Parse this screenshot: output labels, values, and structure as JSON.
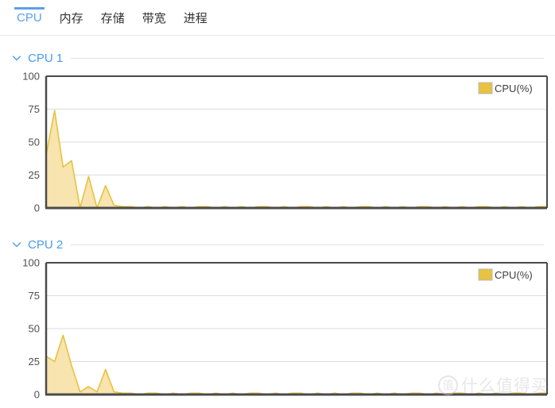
{
  "tabs": [
    {
      "label": "CPU",
      "active": true
    },
    {
      "label": "内存",
      "active": false
    },
    {
      "label": "存储",
      "active": false
    },
    {
      "label": "带宽",
      "active": false
    },
    {
      "label": "进程",
      "active": false
    }
  ],
  "sections": [
    {
      "title": "CPU 1",
      "chevron_icon": "chevron-down-icon"
    },
    {
      "title": "CPU 2",
      "chevron_icon": "chevron-down-icon"
    }
  ],
  "watermark": {
    "badge": "值",
    "text": "什么值得买"
  },
  "colors": {
    "accent": "#4a9ae8",
    "series": "#e8c240",
    "series_fill": "#f7e4ae",
    "axis": "#4a4a4a",
    "grid": "#dcdcdc",
    "tab_active": "#5aa0e8",
    "text": "#333333"
  },
  "chart_data": [
    {
      "type": "area",
      "title": "CPU 1",
      "xlabel": "",
      "ylabel": "",
      "ylim": [
        0,
        100
      ],
      "yticks": [
        0,
        25,
        50,
        75,
        100
      ],
      "grid": true,
      "legend": [
        {
          "name": "CPU(%)",
          "color": "#e8c240"
        }
      ],
      "legend_position": "top-right",
      "series": [
        {
          "name": "CPU(%)",
          "values": [
            40,
            74,
            31,
            36,
            0,
            24,
            0,
            17,
            2,
            1,
            1,
            0,
            1,
            0,
            1,
            0,
            1,
            0,
            1,
            1,
            0,
            1,
            0,
            1,
            0,
            1,
            1,
            0,
            1,
            0,
            1,
            1,
            0,
            1,
            0,
            1,
            0,
            1,
            1,
            0,
            1,
            0,
            1,
            0,
            1,
            1,
            0,
            1,
            0,
            1,
            0,
            1,
            1,
            0,
            1,
            0,
            1,
            0,
            1,
            1
          ]
        }
      ]
    },
    {
      "type": "area",
      "title": "CPU 2",
      "xlabel": "",
      "ylabel": "",
      "ylim": [
        0,
        100
      ],
      "yticks": [
        0,
        25,
        50,
        75,
        100
      ],
      "grid": true,
      "legend": [
        {
          "name": "CPU(%)",
          "color": "#e8c240"
        }
      ],
      "legend_position": "top-right",
      "series": [
        {
          "name": "CPU(%)",
          "values": [
            29,
            25,
            45,
            22,
            2,
            6,
            2,
            19,
            2,
            1,
            1,
            0,
            1,
            1,
            0,
            1,
            0,
            1,
            1,
            0,
            1,
            0,
            1,
            0,
            1,
            1,
            0,
            1,
            0,
            1,
            1,
            0,
            1,
            0,
            1,
            0,
            1,
            1,
            0,
            1,
            0,
            1,
            0,
            1,
            1,
            0,
            1,
            0,
            1,
            1,
            0,
            1,
            0,
            1,
            0,
            1,
            1,
            0,
            1,
            1
          ]
        }
      ]
    }
  ]
}
